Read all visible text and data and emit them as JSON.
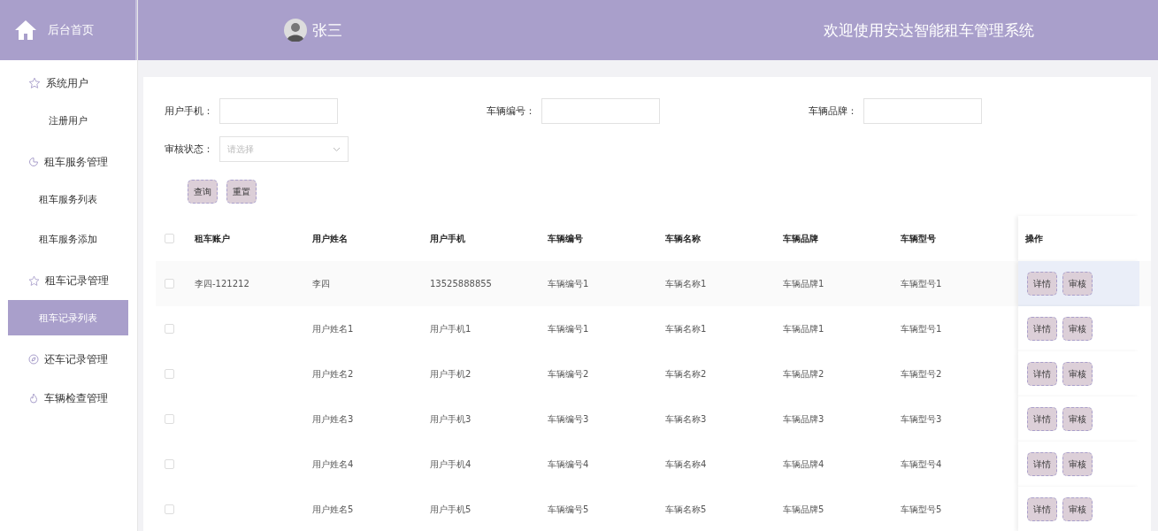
{
  "sidebar": {
    "home": "后台首页",
    "menus": [
      {
        "label": "系统用户",
        "children": [
          {
            "label": "注册用户",
            "selected": false
          }
        ]
      },
      {
        "label": "租车服务管理",
        "children": [
          {
            "label": "租车服务列表",
            "selected": false
          },
          {
            "label": "租车服务添加",
            "selected": false
          }
        ]
      },
      {
        "label": "租车记录管理",
        "children": [
          {
            "label": "租车记录列表",
            "selected": true
          }
        ]
      },
      {
        "label": "还车记录管理"
      },
      {
        "label": "车辆检查管理"
      }
    ]
  },
  "header": {
    "user": "张三",
    "title": "欢迎使用安达智能租车管理系统"
  },
  "filters": [
    {
      "kind": "text",
      "label": "用户手机："
    },
    {
      "kind": "text",
      "label": "车辆编号："
    },
    {
      "kind": "text",
      "label": "车辆品牌："
    },
    {
      "kind": "select",
      "label": "审核状态：",
      "placeholder": "请选择"
    }
  ],
  "buttons": [
    "查询",
    "重置"
  ],
  "table": {
    "select_all": {
      "checked": false
    },
    "columns": [
      "租车账户",
      "用户姓名",
      "用户手机",
      "车辆编号",
      "车辆名称",
      "车辆品牌",
      "车辆型号",
      "操作"
    ],
    "rows": [
      {
        "checked": false,
        "highlighted": true,
        "cells": [
          "李四-121212",
          "李四",
          "13525888855",
          "车辆编号1",
          "车辆名称1",
          "车辆品牌1",
          "车辆型号1"
        ],
        "actions": [
          "详情",
          "审核"
        ]
      },
      {
        "checked": false,
        "highlighted": false,
        "cells": [
          "",
          "用户姓名1",
          "用户手机1",
          "车辆编号1",
          "车辆名称1",
          "车辆品牌1",
          "车辆型号1"
        ],
        "actions": [
          "详情",
          "审核"
        ]
      },
      {
        "checked": false,
        "highlighted": false,
        "cells": [
          "",
          "用户姓名2",
          "用户手机2",
          "车辆编号2",
          "车辆名称2",
          "车辆品牌2",
          "车辆型号2"
        ],
        "actions": [
          "详情",
          "审核"
        ]
      },
      {
        "checked": false,
        "highlighted": false,
        "cells": [
          "",
          "用户姓名3",
          "用户手机3",
          "车辆编号3",
          "车辆名称3",
          "车辆品牌3",
          "车辆型号3"
        ],
        "actions": [
          "详情",
          "审核"
        ]
      },
      {
        "checked": false,
        "highlighted": false,
        "cells": [
          "",
          "用户姓名4",
          "用户手机4",
          "车辆编号4",
          "车辆名称4",
          "车辆品牌4",
          "车辆型号4"
        ],
        "actions": [
          "详情",
          "审核"
        ]
      },
      {
        "checked": false,
        "highlighted": false,
        "cells": [
          "",
          "用户姓名5",
          "用户手机5",
          "车辆编号5",
          "车辆名称5",
          "车辆品牌5",
          "车辆型号5"
        ],
        "actions": [
          "详情",
          "审核"
        ]
      }
    ]
  }
}
